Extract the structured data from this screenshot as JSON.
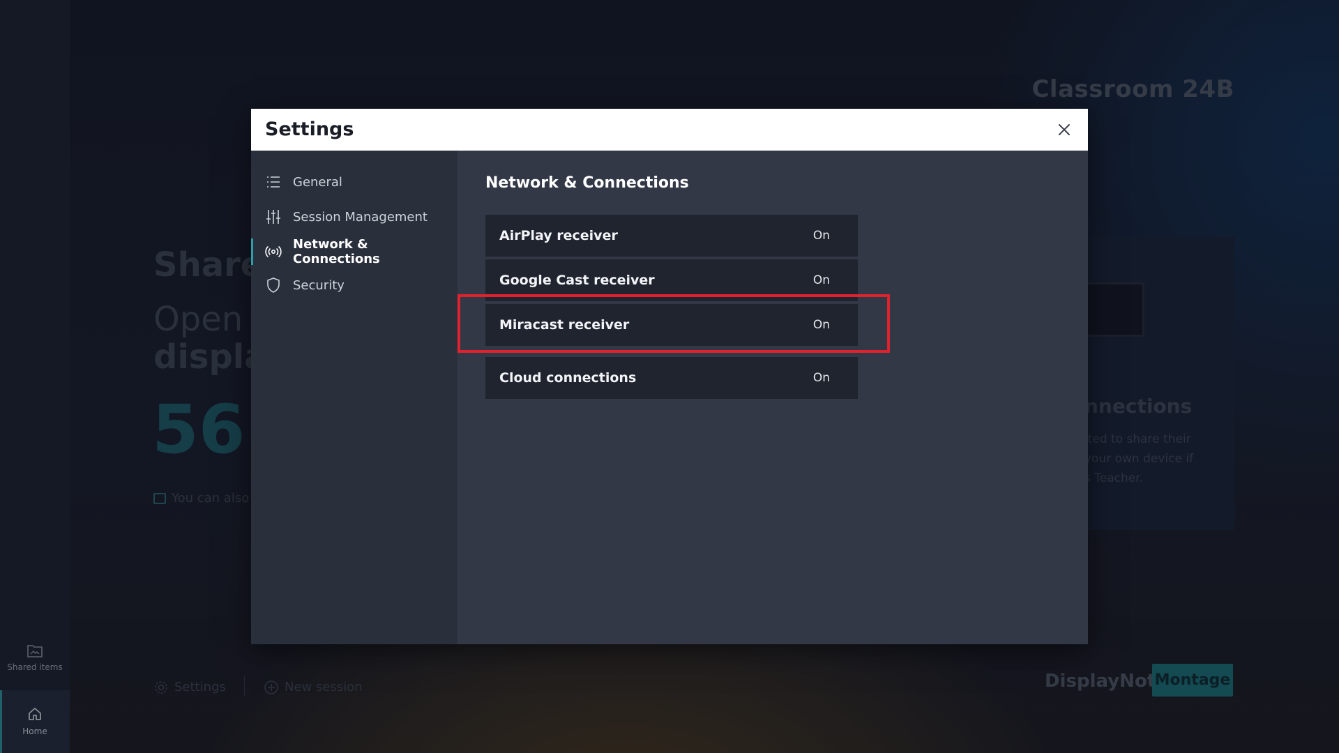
{
  "background": {
    "room_name": "Classroom 24B",
    "share_title": "Share",
    "share_line1": "Open",
    "share_line2": "displa",
    "code_partial": "56",
    "also_text": "You can also",
    "card_title": "nnections",
    "card_text_1": "ited to share their",
    "card_text_2": "your own device if",
    "card_text_3": "s Teacher.",
    "footer": {
      "settings_label": "Settings",
      "new_session_label": "New session"
    },
    "brand": {
      "name": "DisplayNote",
      "product": "Montage"
    }
  },
  "rail": {
    "items": [
      {
        "label": "Shared items",
        "icon": "image-folder-icon"
      },
      {
        "label": "Home",
        "icon": "home-icon",
        "active": true
      }
    ]
  },
  "modal": {
    "title": "Settings",
    "close_icon": "close-icon",
    "nav": [
      {
        "label": "General",
        "icon": "list-icon"
      },
      {
        "label": "Session Management",
        "icon": "sliders-icon"
      },
      {
        "label": "Network & Connections",
        "icon": "broadcast-icon",
        "active": true
      },
      {
        "label": "Security",
        "icon": "shield-icon"
      }
    ],
    "section_title": "Network & Connections",
    "rows": [
      {
        "label": "AirPlay receiver",
        "value": "On"
      },
      {
        "label": "Google Cast receiver",
        "value": "On"
      },
      {
        "label": "Miracast receiver",
        "value": "On",
        "highlighted": true
      },
      {
        "label": "Cloud connections",
        "value": "On"
      }
    ]
  },
  "colors": {
    "accent": "#2aa0ac",
    "highlight": "#e0222f",
    "brand_badge": "#1b6c73"
  }
}
